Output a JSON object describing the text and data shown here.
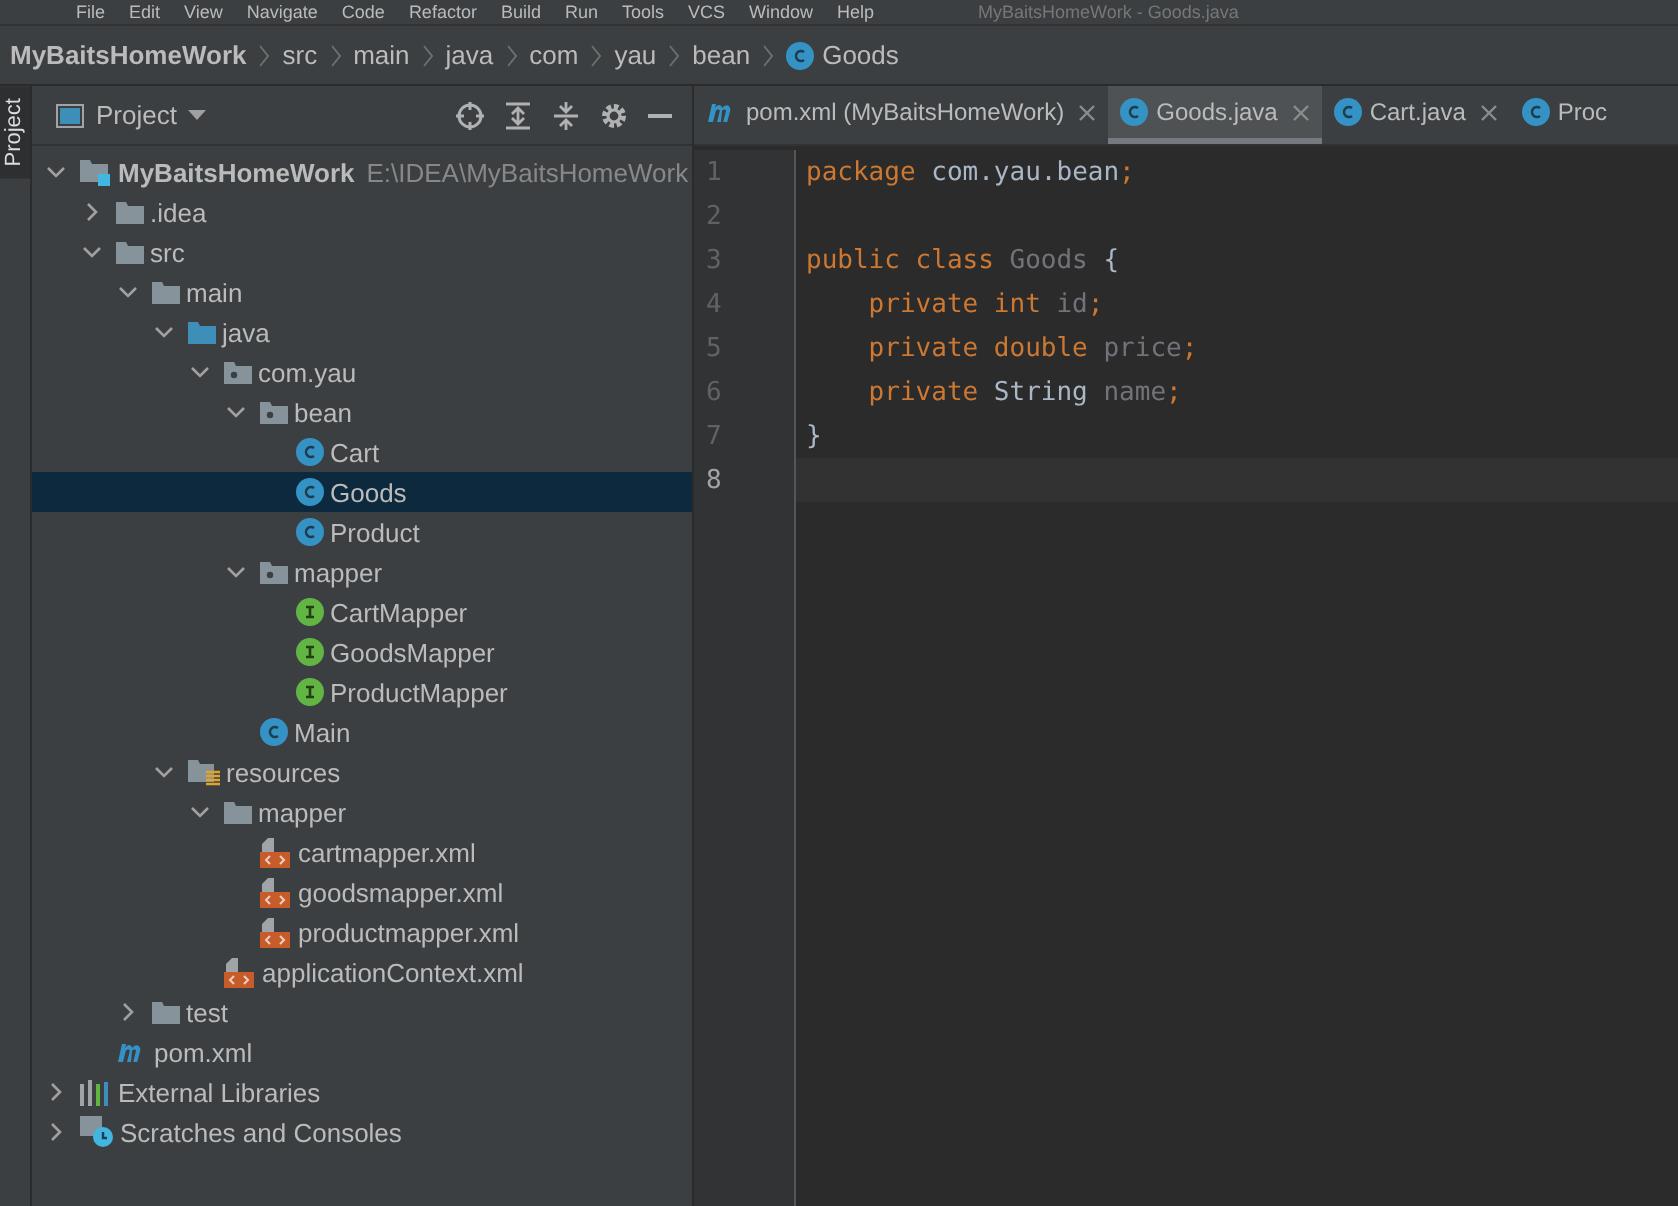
{
  "menu_bar": {
    "items": [
      "File",
      "Edit",
      "View",
      "Navigate",
      "Code",
      "Refactor",
      "Build",
      "Run",
      "Tools",
      "VCS",
      "Window",
      "Help"
    ],
    "title": "MyBaitsHomeWork - Goods.java"
  },
  "breadcrumbs": [
    {
      "label": "MyBaitsHomeWork",
      "kind": "project"
    },
    {
      "label": "src",
      "kind": "plain"
    },
    {
      "label": "main",
      "kind": "plain"
    },
    {
      "label": "java",
      "kind": "plain"
    },
    {
      "label": "com",
      "kind": "plain"
    },
    {
      "label": "yau",
      "kind": "plain"
    },
    {
      "label": "bean",
      "kind": "plain"
    },
    {
      "label": "Goods",
      "kind": "class"
    }
  ],
  "side_strip": {
    "label": "Project"
  },
  "project_panel": {
    "title": "Project",
    "tree": [
      {
        "label": "MyBaitsHomeWork",
        "path": "E:\\IDEA\\MyBaitsHomeWork",
        "kind": "module",
        "expanded": true,
        "selected": false,
        "children": [
          {
            "label": ".idea",
            "kind": "folder",
            "expanded": false,
            "selected": false
          },
          {
            "label": "src",
            "kind": "folder",
            "expanded": true,
            "selected": false,
            "children": [
              {
                "label": "main",
                "kind": "folder",
                "expanded": true,
                "selected": false,
                "children": [
                  {
                    "label": "java",
                    "kind": "source",
                    "expanded": true,
                    "selected": false,
                    "children": [
                      {
                        "label": "com.yau",
                        "kind": "package",
                        "expanded": true,
                        "selected": false,
                        "children": [
                          {
                            "label": "bean",
                            "kind": "package",
                            "expanded": true,
                            "selected": false,
                            "children": [
                              {
                                "label": "Cart",
                                "kind": "class",
                                "selected": false
                              },
                              {
                                "label": "Goods",
                                "kind": "class",
                                "selected": true
                              },
                              {
                                "label": "Product",
                                "kind": "class",
                                "selected": false
                              }
                            ]
                          },
                          {
                            "label": "mapper",
                            "kind": "package",
                            "expanded": true,
                            "selected": false,
                            "children": [
                              {
                                "label": "CartMapper",
                                "kind": "interface",
                                "selected": false
                              },
                              {
                                "label": "GoodsMapper",
                                "kind": "interface",
                                "selected": false
                              },
                              {
                                "label": "ProductMapper",
                                "kind": "interface",
                                "selected": false
                              }
                            ]
                          },
                          {
                            "label": "Main",
                            "kind": "class",
                            "selected": false
                          }
                        ]
                      }
                    ]
                  },
                  {
                    "label": "resources",
                    "kind": "resources",
                    "expanded": true,
                    "selected": false,
                    "children": [
                      {
                        "label": "mapper",
                        "kind": "folder",
                        "expanded": true,
                        "selected": false,
                        "children": [
                          {
                            "label": "cartmapper.xml",
                            "kind": "xml",
                            "selected": false
                          },
                          {
                            "label": "goodsmapper.xml",
                            "kind": "xml",
                            "selected": false
                          },
                          {
                            "label": "productmapper.xml",
                            "kind": "xml",
                            "selected": false
                          }
                        ]
                      },
                      {
                        "label": "applicationContext.xml",
                        "kind": "xml",
                        "selected": false
                      }
                    ]
                  }
                ]
              },
              {
                "label": "test",
                "kind": "folder",
                "expanded": false,
                "selected": false
              }
            ]
          },
          {
            "label": "pom.xml",
            "kind": "maven",
            "selected": false
          }
        ]
      },
      {
        "label": "External Libraries",
        "kind": "libraries",
        "expanded": false,
        "selected": false
      },
      {
        "label": "Scratches and Consoles",
        "kind": "scratches",
        "expanded": false,
        "selected": false
      }
    ]
  },
  "editor": {
    "tabs": [
      {
        "label": "pom.xml (MyBaitsHomeWork)",
        "kind": "maven",
        "selected": false,
        "closable": true
      },
      {
        "label": "Goods.java",
        "kind": "class",
        "selected": true,
        "closable": true
      },
      {
        "label": "Cart.java",
        "kind": "class",
        "selected": false,
        "closable": true
      },
      {
        "label": "Proc",
        "kind": "class",
        "selected": false,
        "closable": false
      }
    ],
    "lines": [
      {
        "number": "1",
        "current": false,
        "tokens": [
          {
            "text": "package ",
            "kind": "keyword"
          },
          {
            "text": "com.yau.bean",
            "kind": "plain"
          },
          {
            "text": ";",
            "kind": "keyword"
          }
        ]
      },
      {
        "number": "2",
        "current": false
      },
      {
        "number": "3",
        "current": false,
        "tokens": [
          {
            "text": "public class ",
            "kind": "keyword"
          },
          {
            "text": "Goods ",
            "kind": "unused"
          },
          {
            "text": "{",
            "kind": "plain"
          }
        ]
      },
      {
        "number": "4",
        "current": false,
        "tokens": [
          {
            "text": "    private int ",
            "kind": "keyword"
          },
          {
            "text": "id",
            "kind": "unused"
          },
          {
            "text": ";",
            "kind": "keyword"
          }
        ]
      },
      {
        "number": "5",
        "current": false,
        "tokens": [
          {
            "text": "    private double ",
            "kind": "keyword"
          },
          {
            "text": "price",
            "kind": "unused"
          },
          {
            "text": ";",
            "kind": "keyword"
          }
        ]
      },
      {
        "number": "6",
        "current": false,
        "tokens": [
          {
            "text": "    private ",
            "kind": "keyword"
          },
          {
            "text": "String ",
            "kind": "plain"
          },
          {
            "text": "name",
            "kind": "unused"
          },
          {
            "text": ";",
            "kind": "keyword"
          }
        ]
      },
      {
        "number": "7",
        "current": false,
        "tokens": [
          {
            "text": "}",
            "kind": "plain"
          }
        ]
      },
      {
        "number": "8",
        "current": true
      }
    ]
  }
}
